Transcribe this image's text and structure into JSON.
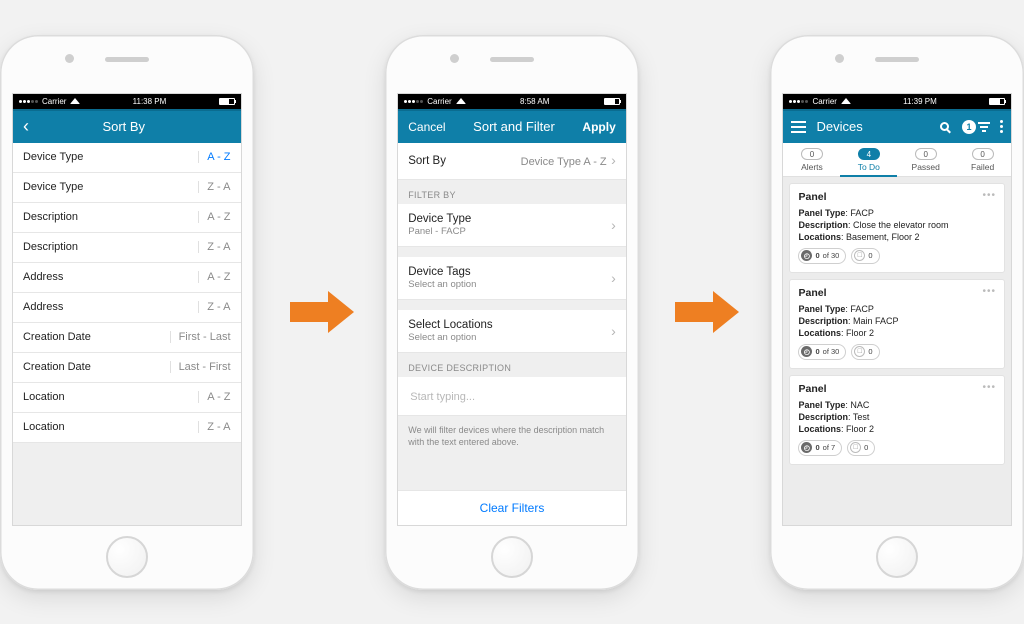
{
  "status": {
    "carrier": "Carrier",
    "time1": "11:38 PM",
    "time2": "8:58 AM",
    "time3": "11:39 PM"
  },
  "screen1": {
    "title": "Sort By",
    "rows": [
      {
        "label": "Device Type",
        "value": "A - Z",
        "selected": true
      },
      {
        "label": "Device Type",
        "value": "Z - A"
      },
      {
        "label": "Description",
        "value": "A - Z"
      },
      {
        "label": "Description",
        "value": "Z - A"
      },
      {
        "label": "Address",
        "value": "A - Z"
      },
      {
        "label": "Address",
        "value": "Z - A"
      },
      {
        "label": "Creation Date",
        "value": "First - Last"
      },
      {
        "label": "Creation Date",
        "value": "Last - First"
      },
      {
        "label": "Location",
        "value": "A - Z"
      },
      {
        "label": "Location",
        "value": "Z - A"
      }
    ]
  },
  "screen2": {
    "cancel": "Cancel",
    "title": "Sort and Filter",
    "apply": "Apply",
    "sortby_label": "Sort By",
    "sortby_value": "Device Type A - Z",
    "filterby_head": "FILTER BY",
    "devtype_label": "Device Type",
    "devtype_sub": "Panel - FACP",
    "devtags_label": "Device Tags",
    "devtags_sub": "Select an option",
    "loc_label": "Select Locations",
    "loc_sub": "Select an option",
    "desc_head": "DEVICE DESCRIPTION",
    "desc_placeholder": "Start typing...",
    "desc_hint": "We will filter devices where the description match with the text entered above.",
    "clear": "Clear Filters"
  },
  "screen3": {
    "title": "Devices",
    "filter_badge": "1",
    "tabs": [
      {
        "count": "0",
        "label": "Alerts"
      },
      {
        "count": "4",
        "label": "To Do",
        "active": true
      },
      {
        "count": "0",
        "label": "Passed"
      },
      {
        "count": "0",
        "label": "Failed"
      }
    ],
    "cards": [
      {
        "title": "Panel",
        "panel_type": "FACP",
        "description": "Close the elevator room",
        "locations": "Basement, Floor 2",
        "prog": "0 of 30",
        "notes": "0"
      },
      {
        "title": "Panel",
        "panel_type": "FACP",
        "description": "Main FACP",
        "locations": "Floor 2",
        "prog": "0 of 30",
        "notes": "0"
      },
      {
        "title": "Panel",
        "panel_type": "NAC",
        "description": "Test",
        "locations": "Floor 2",
        "prog": "0 of 7",
        "notes": "0"
      }
    ],
    "labels": {
      "panel_type": "Panel Type",
      "description": "Description",
      "locations": "Locations"
    }
  }
}
